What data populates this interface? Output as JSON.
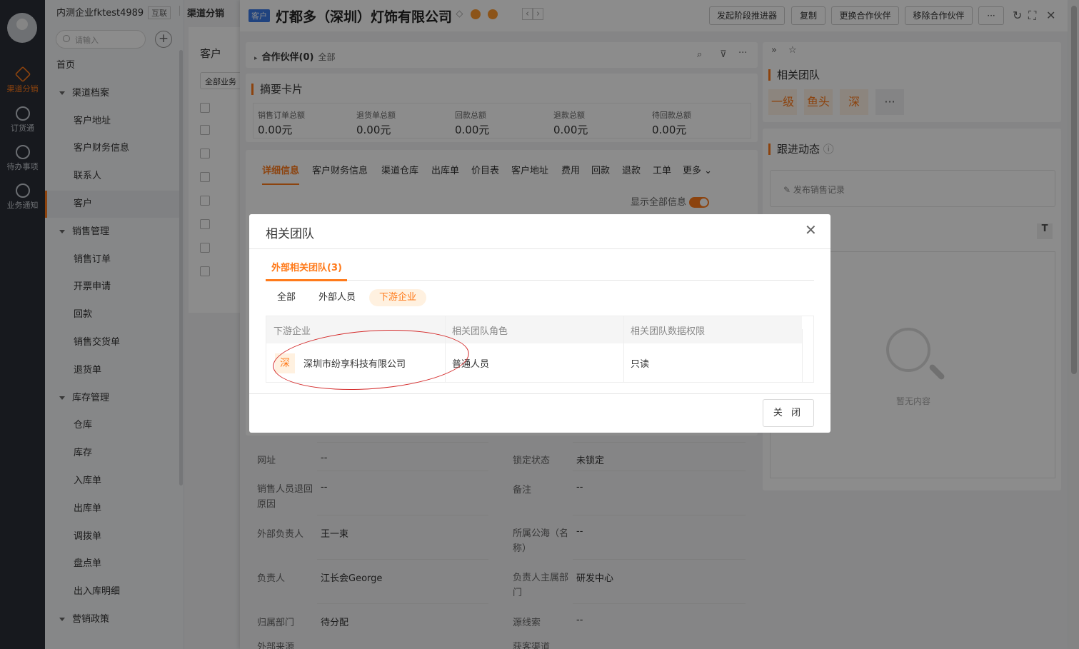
{
  "rail": {
    "items": [
      {
        "label": "渠道分销",
        "icon": "box-icon",
        "active": true
      },
      {
        "label": "订货通",
        "icon": "order-icon"
      },
      {
        "label": "待办事项",
        "icon": "check-circle-icon"
      },
      {
        "label": "业务通知",
        "icon": "bell-icon"
      }
    ]
  },
  "nav": {
    "tenant": "内测企业fktest4989",
    "tenant_tag": "互联",
    "breadcrumb": "渠道分销",
    "search_placeholder": "请输入",
    "items": [
      {
        "label": "首页",
        "kind": "top"
      },
      {
        "label": "渠道档案",
        "kind": "group"
      },
      {
        "label": "客户地址",
        "kind": "sub"
      },
      {
        "label": "客户财务信息",
        "kind": "sub"
      },
      {
        "label": "联系人",
        "kind": "sub"
      },
      {
        "label": "客户",
        "kind": "sub",
        "selected": true
      },
      {
        "label": "销售管理",
        "kind": "group"
      },
      {
        "label": "销售订单",
        "kind": "sub"
      },
      {
        "label": "开票申请",
        "kind": "sub"
      },
      {
        "label": "回款",
        "kind": "sub"
      },
      {
        "label": "销售交货单",
        "kind": "sub"
      },
      {
        "label": "退货单",
        "kind": "sub"
      },
      {
        "label": "库存管理",
        "kind": "group"
      },
      {
        "label": "仓库",
        "kind": "sub"
      },
      {
        "label": "库存",
        "kind": "sub"
      },
      {
        "label": "入库单",
        "kind": "sub"
      },
      {
        "label": "出库单",
        "kind": "sub"
      },
      {
        "label": "调拨单",
        "kind": "sub"
      },
      {
        "label": "盘点单",
        "kind": "sub"
      },
      {
        "label": "出入库明细",
        "kind": "sub"
      },
      {
        "label": "营销政策",
        "kind": "group"
      }
    ]
  },
  "list": {
    "title": "客户",
    "filter": "全部业务"
  },
  "detail": {
    "tag": "客户",
    "title": "灯都多（深圳）灯饰有限公司",
    "buttons": [
      "发起阶段推进器",
      "复制",
      "更换合作伙伴",
      "移除合作伙伴",
      "···"
    ],
    "partner": {
      "label": "合作伙伴(0)",
      "filter": "全部"
    },
    "summary": {
      "title": "摘要卡片",
      "items": [
        {
          "label": "销售订单总额",
          "value": "0.00元"
        },
        {
          "label": "退货单总额",
          "value": "0.00元"
        },
        {
          "label": "回款总额",
          "value": "0.00元"
        },
        {
          "label": "退款总额",
          "value": "0.00元"
        },
        {
          "label": "待回款总额",
          "value": "0.00元"
        }
      ]
    },
    "tabs": [
      "详细信息",
      "客户财务信息",
      "渠道仓库",
      "出库单",
      "价目表",
      "客户地址",
      "费用",
      "回款",
      "退款",
      "工单",
      "更多"
    ],
    "show_all": "显示全部信息",
    "fields": [
      {
        "k": "网址",
        "v": "--",
        "k2": "锁定状态",
        "v2": "未锁定"
      },
      {
        "k": "销售人员退回原因",
        "v": "--",
        "k2": "备注",
        "v2": "--"
      },
      {
        "k": "外部负责人",
        "v": "王一束",
        "k2": "所属公海（名称）",
        "v2": "--"
      },
      {
        "k": "负责人",
        "v": "江长会George",
        "k2": "负责人主属部门",
        "v2": "研发中心"
      },
      {
        "k": "归属部门",
        "v": "待分配",
        "k2": "源线索",
        "v2": "--"
      },
      {
        "k": "外部来源",
        "v": "",
        "k2": "获客渠道",
        "v2": ""
      }
    ]
  },
  "right": {
    "team_title": "相关团队",
    "team_avatars": [
      "一级",
      "鱼头",
      "深",
      "···"
    ],
    "follow_title": "跟进动态",
    "publish": "发布销售记录",
    "empty": "暂无内容"
  },
  "modal": {
    "title": "相关团队",
    "tab": "外部相关团队(3)",
    "chips": [
      "全部",
      "外部人员",
      "下游企业"
    ],
    "active_chip": "下游企业",
    "columns": [
      "下游企业",
      "相关团队角色",
      "相关团队数据权限"
    ],
    "row": {
      "logo": "深",
      "company": "深圳市纷享科技有限公司",
      "role": "普通人员",
      "permission": "只读"
    },
    "close_button": "关 闭"
  },
  "colors": {
    "accent": "#ff7a1a",
    "rail": "#2b2f38",
    "annotation": "#d42a2a"
  }
}
